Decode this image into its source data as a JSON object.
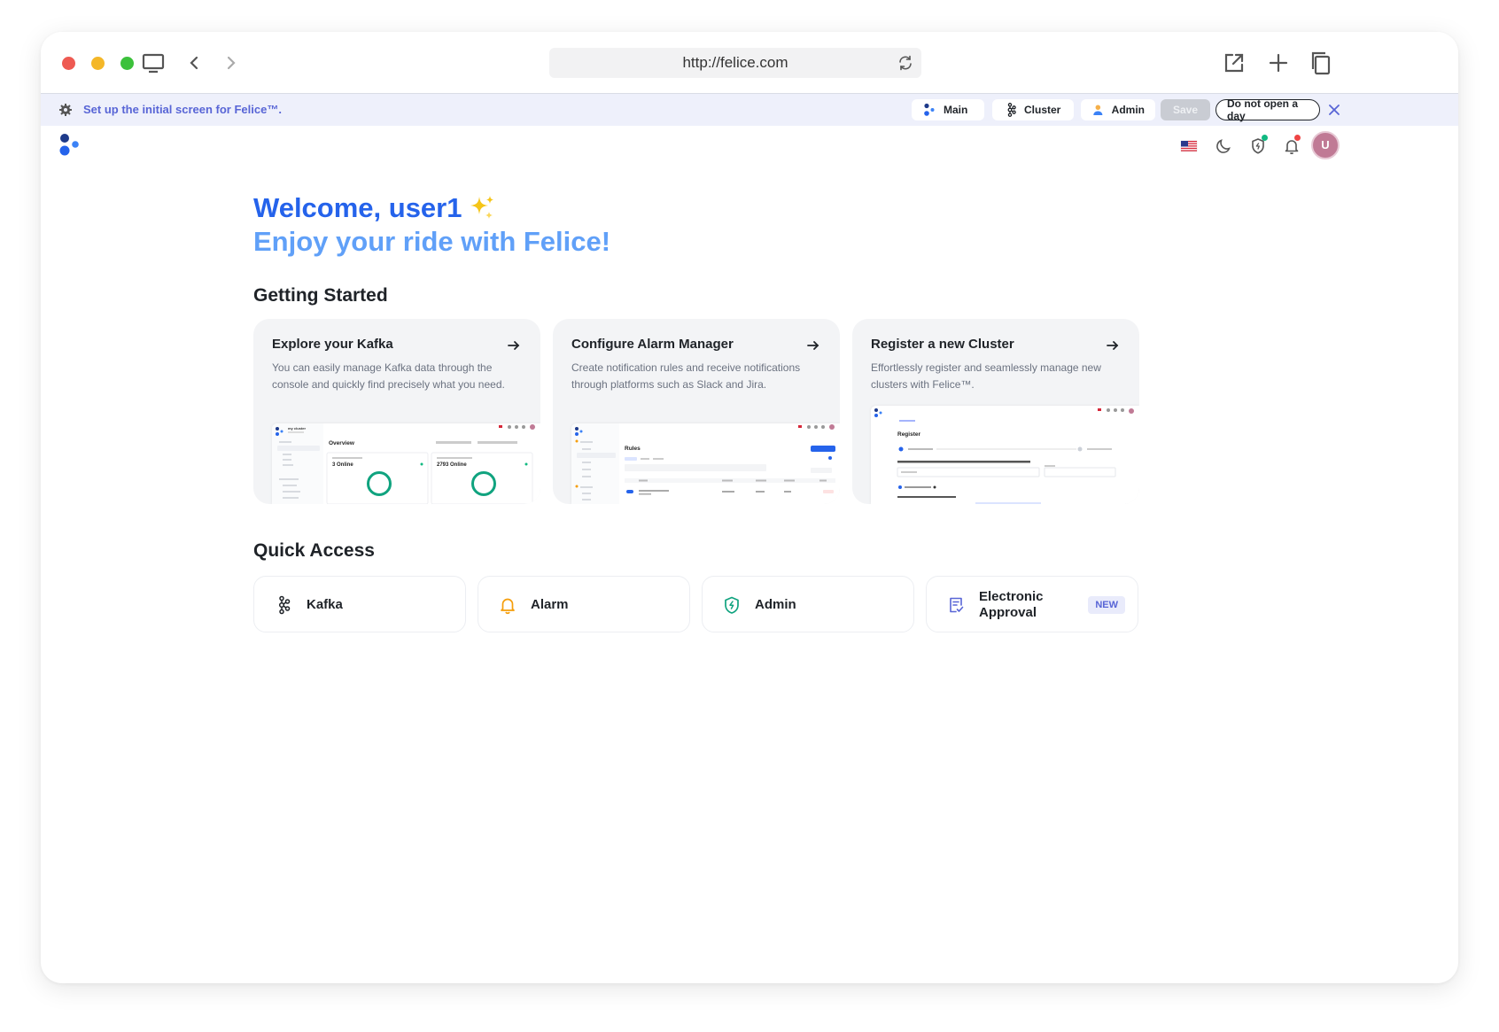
{
  "browser": {
    "url": "http://felice.com"
  },
  "banner": {
    "text": "Set up the initial screen for Felice™.",
    "main_label": "Main",
    "cluster_label": "Cluster",
    "admin_label": "Admin",
    "save_label": "Save",
    "dismiss_label": "Do not open a day"
  },
  "header": {
    "avatar_initial": "U",
    "icons": [
      "flag-us-icon",
      "moon-icon",
      "shield-icon",
      "bell-icon"
    ]
  },
  "welcome": {
    "line1": "Welcome, user1",
    "line2": "Enjoy your ride with Felice!"
  },
  "getting_started": {
    "title": "Getting Started",
    "cards": [
      {
        "title": "Explore your Kafka",
        "desc": "You can easily manage Kafka data through the console and quickly find precisely what you need.",
        "preview": {
          "cluster_name": "my cluster",
          "heading": "Overview",
          "stat1": "3 Online",
          "stat2": "2793 Online"
        }
      },
      {
        "title": "Configure Alarm Manager",
        "desc": "Create notification rules and receive notifications through platforms such as Slack and Jira.",
        "preview": {
          "heading": "Rules"
        }
      },
      {
        "title": "Register a new Cluster",
        "desc": "Effortlessly register and seamlessly manage new clusters with Felice™.",
        "preview": {
          "heading": "Register"
        }
      }
    ]
  },
  "quick_access": {
    "title": "Quick Access",
    "items": [
      {
        "label": "Kafka",
        "icon": "kafka-icon"
      },
      {
        "label": "Alarm",
        "icon": "bell-icon"
      },
      {
        "label": "Admin",
        "icon": "shield-icon"
      },
      {
        "label": "Electronic Approval",
        "icon": "document-check-icon",
        "badge": "NEW"
      }
    ]
  },
  "colors": {
    "accent_blue": "#2563eb",
    "light_blue": "#60a0f8",
    "banner_text": "#5865d6",
    "alarm_orange": "#f59e0b",
    "admin_green": "#10a37f"
  }
}
